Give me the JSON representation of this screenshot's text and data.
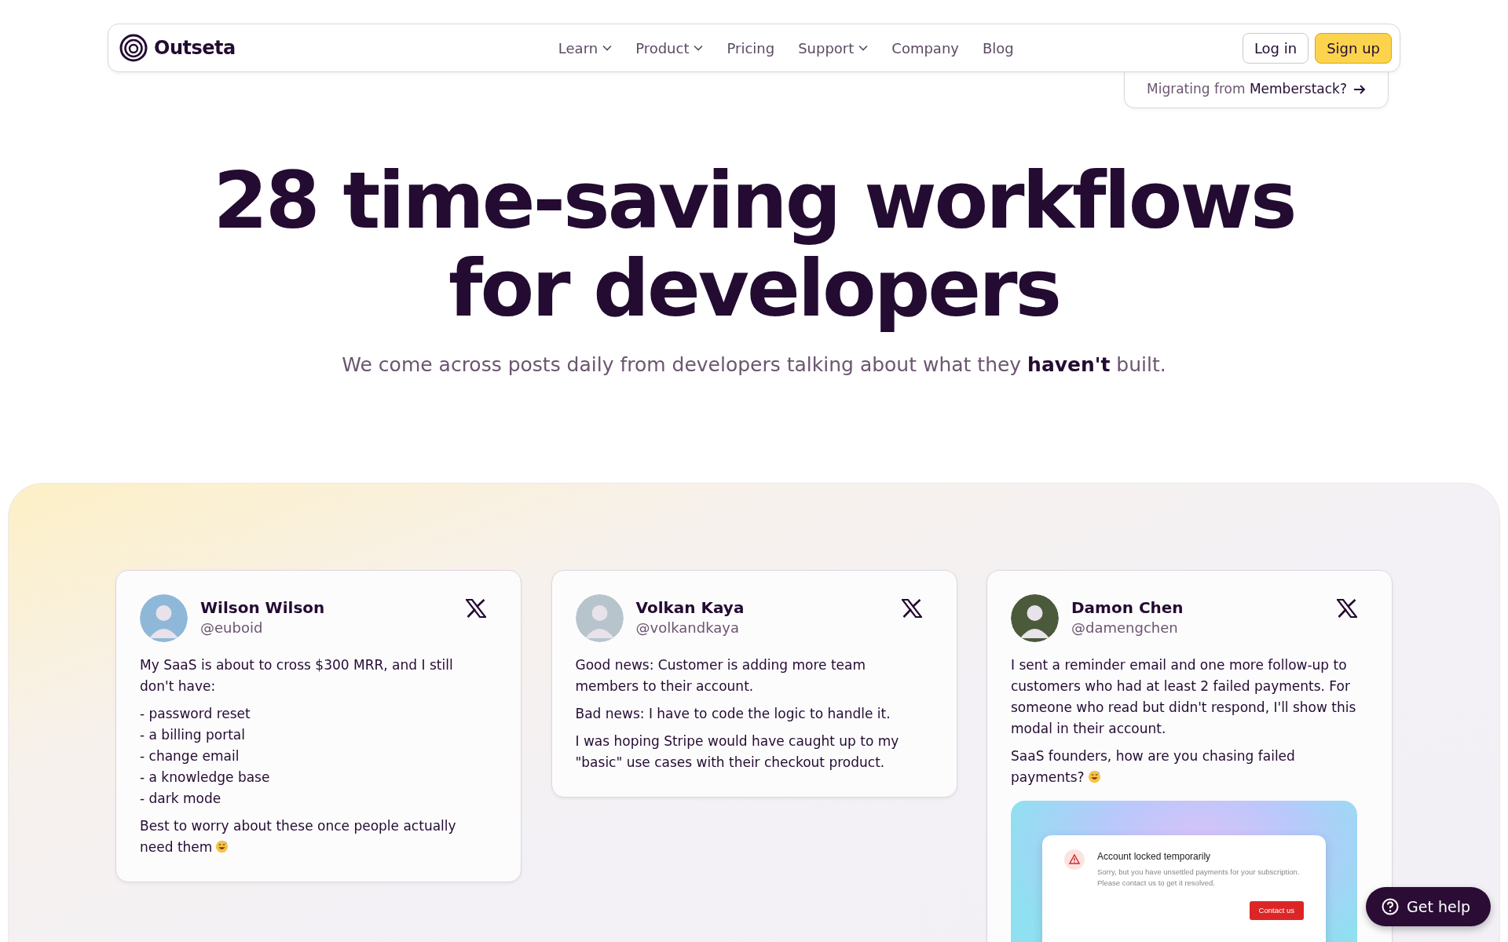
{
  "nav": {
    "logo": "Outseta",
    "links": [
      {
        "label": "Learn",
        "dropdown": true
      },
      {
        "label": "Product",
        "dropdown": true
      },
      {
        "label": "Pricing",
        "dropdown": false
      },
      {
        "label": "Support",
        "dropdown": true
      },
      {
        "label": "Company",
        "dropdown": false
      },
      {
        "label": "Blog",
        "dropdown": false
      }
    ],
    "login": "Log in",
    "signup": "Sign up",
    "banner": "Migrating from **Memberstack?**"
  },
  "hero": {
    "title_lines": [
      "28 time-saving workflows",
      "for developers"
    ],
    "subtitle": "We come across posts daily from developers talking about what they **haven't** built."
  },
  "tweets": [
    {
      "name": "Wilson Wilson",
      "handle": "@euboid",
      "paragraphs": [
        {
          "text": "My SaaS is about to cross $300 MRR, and I still don't have:",
          "emoji": false
        },
        {
          "text": "- password reset\n- a billing portal\n- change email\n- a knowledge base\n- dark mode",
          "emoji": false
        },
        {
          "text": "Best to worry about these once people actually need them",
          "emoji": true
        }
      ]
    },
    {
      "name": "Volkan Kaya",
      "handle": "@volkandkaya",
      "paragraphs": [
        {
          "text": "Good news: Customer is adding more team members to their account.",
          "emoji": false
        },
        {
          "text": "Bad news: I have to code the logic to handle it.",
          "emoji": false
        },
        {
          "text": "I was hoping Stripe would have caught up to my \"basic\" use cases with their checkout product.",
          "emoji": false
        }
      ]
    },
    {
      "name": "Damon Chen",
      "handle": "@damengchen",
      "paragraphs": [
        {
          "text": "I sent a reminder email and one more follow-up to customers who had at least 2 failed payments. For someone who read but didn't respond, I'll show this modal in their account.",
          "emoji": false
        },
        {
          "text": "SaaS founders, how are you chasing failed payments?",
          "emoji": true
        }
      ],
      "attachment": {
        "title": "Account locked temporarily",
        "message": "Sorry, but you have unsettled payments for your subscription. Please contact us to get it resolved.",
        "button": "Contact us"
      }
    }
  ],
  "help_button": "Get help"
}
